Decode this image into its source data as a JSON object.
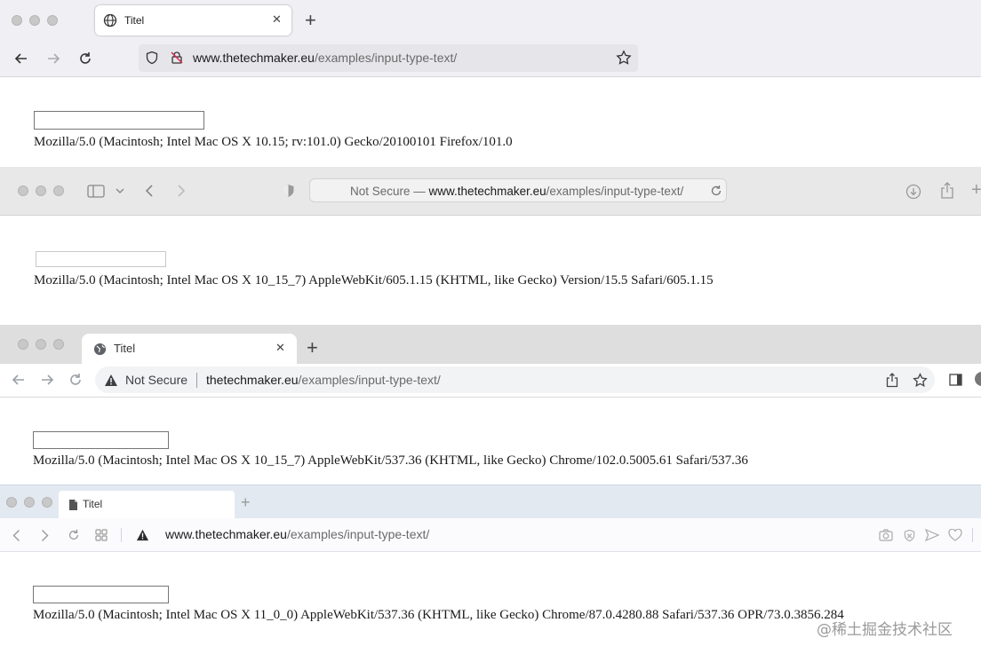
{
  "firefox": {
    "tab_title": "Titel",
    "url_domain": "www.thetechmaker.eu",
    "url_path": "/examples/input-type-text/",
    "user_agent": "Mozilla/5.0 (Macintosh; Intel Mac OS X 10.15; rv:101.0) Gecko/20100101 Firefox/101.0"
  },
  "safari": {
    "url_prefix": "Not Secure — ",
    "url_domain": "www.thetechmaker.eu",
    "url_path": "/examples/input-type-text/",
    "user_agent": "Mozilla/5.0 (Macintosh; Intel Mac OS X 10_15_7) AppleWebKit/605.1.15 (KHTML, like Gecko) Version/15.5 Safari/605.1.15"
  },
  "chrome": {
    "tab_title": "Titel",
    "security_label": "Not Secure",
    "url_domain": "thetechmaker.eu",
    "url_path": "/examples/input-type-text/",
    "user_agent": "Mozilla/5.0 (Macintosh; Intel Mac OS X 10_15_7) AppleWebKit/537.36 (KHTML, like Gecko) Chrome/102.0.5005.61 Safari/537.36"
  },
  "opera": {
    "tab_title": "Titel",
    "url_domain": "www.thetechmaker.eu",
    "url_path": "/examples/input-type-text/",
    "user_agent": "Mozilla/5.0 (Macintosh; Intel Mac OS X 11_0_0) AppleWebKit/537.36 (KHTML, like Gecko) Chrome/87.0.4280.88 Safari/537.36 OPR/73.0.3856.284"
  },
  "watermark": "@稀土掘金技术社区",
  "glyphs": {
    "plus": "+",
    "close": "✕",
    "star": "☆",
    "back": "‹",
    "forward": "›"
  },
  "icons": [
    "globe-icon",
    "shield-icon",
    "lock-slash-icon",
    "star-icon",
    "back-icon",
    "forward-icon",
    "reload-icon",
    "sidebar-icon",
    "download-icon",
    "share-icon",
    "warning-icon",
    "document-icon",
    "camera-icon",
    "heart-icon"
  ]
}
